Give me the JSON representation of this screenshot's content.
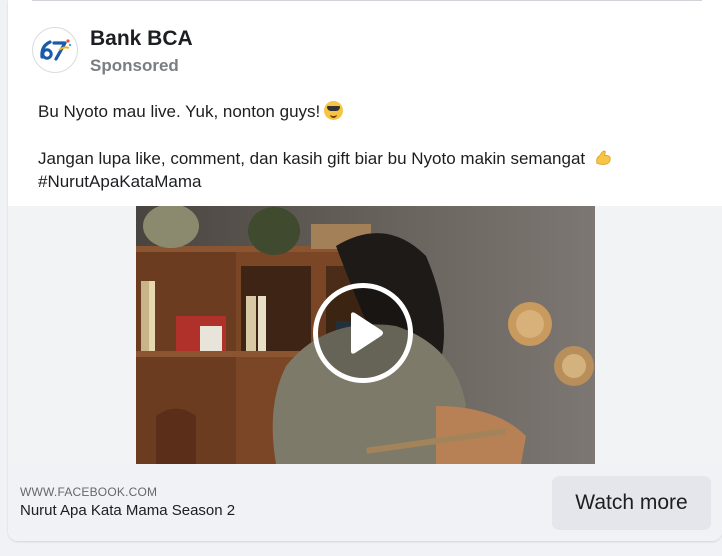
{
  "post": {
    "page_name": "Bank BCA",
    "sponsored_label": "Sponsored",
    "avatar_icon": "bca-67-anniversary-logo",
    "text_line1": "Bu Nyoto mau live. Yuk, nonton guys!",
    "emoji1": "smiling-face-with-sunglasses",
    "text_line2": "Jangan lupa like, comment, dan kasih gift biar bu Nyoto makin semangat",
    "emoji2": "flexed-biceps",
    "hashtag": "#NurutApaKataMama"
  },
  "media": {
    "type": "video",
    "play_icon": "play-icon"
  },
  "link": {
    "domain": "WWW.FACEBOOK.COM",
    "title": "Nurut Apa Kata Mama Season 2",
    "cta_label": "Watch more"
  },
  "colors": {
    "card_bg": "#ffffff",
    "footer_bg": "#f0f2f5",
    "button_bg": "#e4e6eb",
    "secondary_text": "#65676b",
    "bca_blue": "#1a5aa8"
  }
}
